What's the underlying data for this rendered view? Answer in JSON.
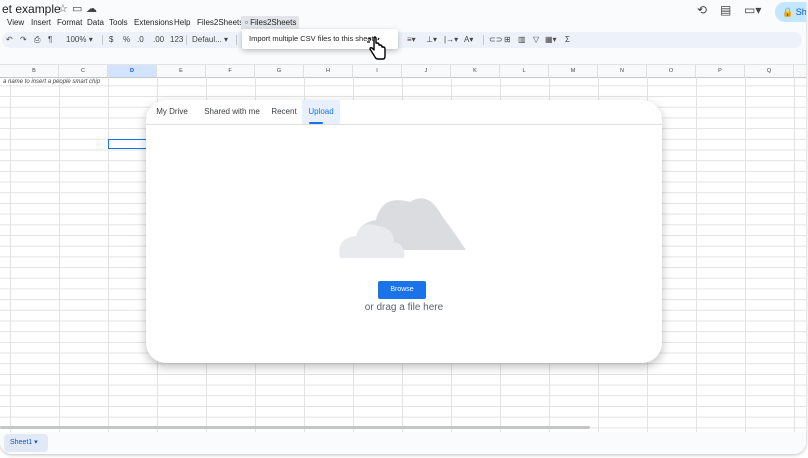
{
  "title_bar": {
    "doc_title": "et example",
    "icons": [
      "star-icon",
      "folder-move-icon",
      "cloud-status-icon"
    ],
    "right_icons": [
      "history-icon",
      "comments-icon",
      "meet-icon"
    ],
    "share_label": "Sh"
  },
  "menu": {
    "items": [
      "View",
      "Insert",
      "Format",
      "Data",
      "Tools",
      "Extensions",
      "Help",
      "Files2Sheets"
    ],
    "open_item": "Files2Sheets"
  },
  "toolbar": {
    "zoom": "100%",
    "currency": "$",
    "percent": "%",
    "decrease_decimals": ".0",
    "increase_decimals": ".00",
    "number_format": "123",
    "font": "Defaul...",
    "function_symbol": "Σ"
  },
  "dropdown": {
    "item": "Import multiple CSV files to this sheet"
  },
  "grid": {
    "columns": [
      "B",
      "C",
      "D",
      "E",
      "F",
      "G",
      "H",
      "I",
      "J",
      "K",
      "L",
      "M",
      "N",
      "O",
      "P",
      "Q"
    ],
    "selected_column": "D",
    "cell_note": "a name to insert a people smart chip"
  },
  "picker": {
    "tabs": [
      "My Drive",
      "Shared with me",
      "Recent",
      "Upload"
    ],
    "active_tab": "Upload",
    "browse_label": "Browse",
    "drag_text": "or drag a file here",
    "colors": {
      "accent": "#1a73e8",
      "cloud_dark": "#dadce0",
      "cloud_light": "#e8eaed"
    }
  },
  "sheets": {
    "active": "Sheet1 ▾"
  }
}
